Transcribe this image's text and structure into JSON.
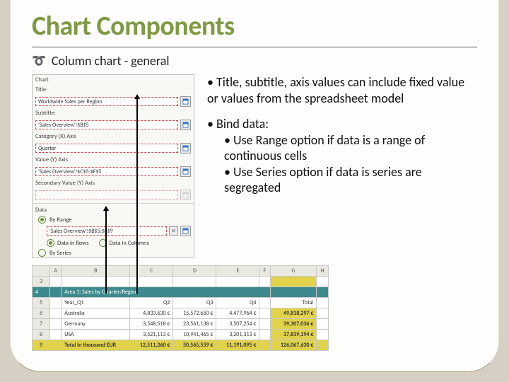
{
  "title": "Chart Components",
  "subhead": "Column chart - general",
  "bullets": {
    "p1": "• Title, subtitle, axis values can include fixed value or values from the spreadsheet model",
    "p2": "• Bind data:",
    "p2a": "• Use Range option if data is a range of continuous cells",
    "p2b": "• Use Series option if data is series are segregated"
  },
  "panel": {
    "titles": {
      "chart_lbl": "Chart",
      "title_lbl": "Title:",
      "title_val": "Worldwide Sales per Region",
      "subtitle_lbl": "Subtitle:",
      "subtitle_val": "'Sales Overview'!$B$5",
      "catx_lbl": "Category (X) Axis",
      "quarter_lbl": "Quarter",
      "valy_lbl": "Value (Y) Axis",
      "valy_val": "'Sales Overview'!$C$5:$F$5",
      "secv_lbl": "Secondary Value (Y) Axis"
    },
    "data": {
      "section": "Data",
      "by_range": "By Range",
      "by_series": "By Series",
      "range_val": "'Sales Overview'!$B$5:$F$9",
      "in_rows": "Data in Rows",
      "in_cols": "Data in Columns"
    }
  },
  "sheet": {
    "cols": [
      "",
      "A",
      "B",
      "C",
      "D",
      "E",
      "F",
      "G",
      "H"
    ],
    "rows": [
      {
        "num": "3",
        "cells": [
          "",
          "",
          "",
          "",
          "",
          "",
          "",
          ""
        ]
      },
      {
        "num": "4",
        "cells": [
          "",
          "Area 1: Sales by Quarter/Region",
          "",
          "",
          "",
          "",
          "",
          ""
        ],
        "hdr": true,
        "span": 5
      },
      {
        "num": "5",
        "cells": [
          "",
          "Year_Q1",
          "Q2",
          "Q3",
          "Q4",
          "",
          "Total",
          ""
        ],
        "sub": true
      },
      {
        "num": "6",
        "cells": [
          "",
          "Australia",
          "4,833,630 €",
          "15,572,650 €",
          "4,477,964 €",
          "",
          "49,818,297 €",
          ""
        ]
      },
      {
        "num": "7",
        "cells": [
          "",
          "Germany",
          "3,548,518 €",
          "23,561,138 €",
          "3,507,254 €",
          "",
          "39,307,036 €",
          ""
        ]
      },
      {
        "num": "8",
        "cells": [
          "",
          "USA",
          "3,521,113 €",
          "10,941,465 €",
          "3,201,313 €",
          "",
          "37,839,194 €",
          ""
        ]
      },
      {
        "num": "9",
        "cells": [
          "",
          "Total in thousand EUR",
          "12,511,260 €",
          "50,565,559 €",
          "11,191,095 €",
          "",
          "126,067,630 €",
          ""
        ],
        "tot": true
      }
    ]
  }
}
